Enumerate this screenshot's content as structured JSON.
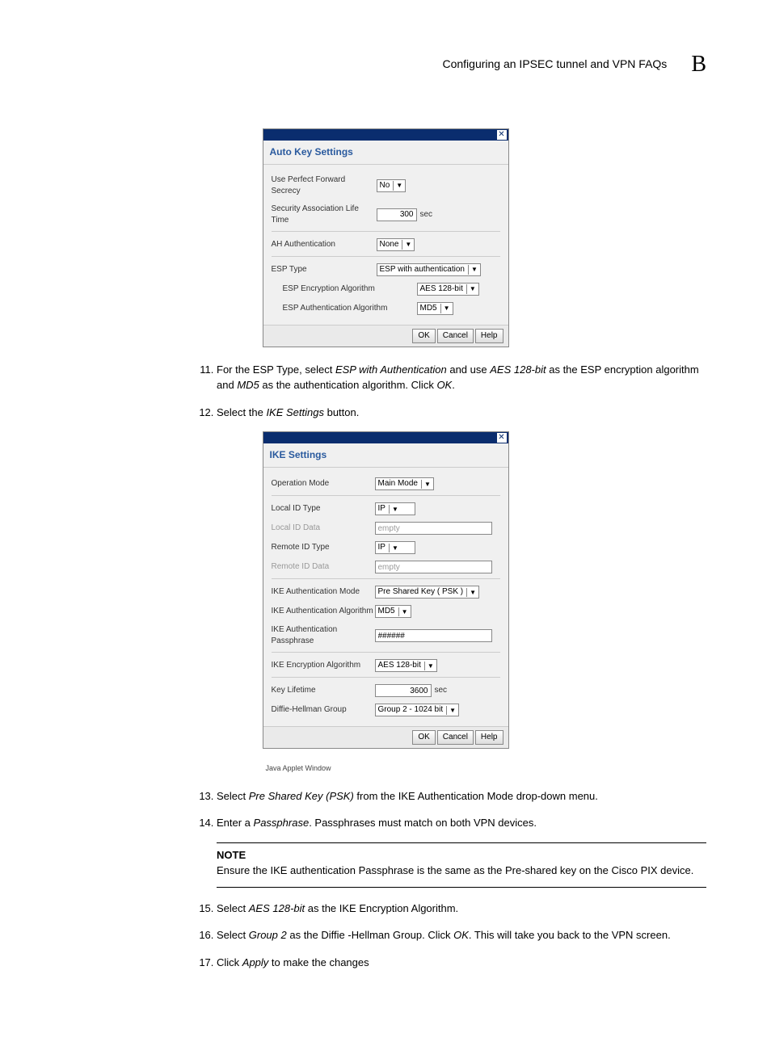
{
  "header": {
    "title": "Configuring an IPSEC tunnel and VPN FAQs",
    "appendix": "B"
  },
  "dialog1": {
    "title": "Auto Key Settings",
    "rows": {
      "pfs": {
        "label": "Use Perfect Forward Secrecy",
        "value": "No"
      },
      "saLife": {
        "label": "Security Association Life Time",
        "value": "300",
        "unit": "sec"
      },
      "ahAuth": {
        "label": "AH Authentication",
        "value": "None"
      },
      "espType": {
        "label": "ESP Type",
        "value": "ESP with authentication"
      },
      "espEnc": {
        "label": "ESP Encryption Algorithm",
        "value": "AES 128-bit"
      },
      "espAuth": {
        "label": "ESP Authentication Algorithm",
        "value": "MD5"
      }
    },
    "buttons": {
      "ok": "OK",
      "cancel": "Cancel",
      "help": "Help"
    }
  },
  "dialog2": {
    "title": "IKE Settings",
    "rows": {
      "opMode": {
        "label": "Operation Mode",
        "value": "Main Mode"
      },
      "localIdType": {
        "label": "Local ID Type",
        "value": "IP"
      },
      "localIdData": {
        "label": "Local ID Data",
        "value": "empty"
      },
      "remoteIdType": {
        "label": "Remote ID Type",
        "value": "IP"
      },
      "remoteIdData": {
        "label": "Remote ID Data",
        "value": "empty"
      },
      "ikeAuthMode": {
        "label": "IKE Authentication Mode",
        "value": "Pre Shared Key ( PSK )"
      },
      "ikeAuthAlg": {
        "label": "IKE Authentication Algorithm",
        "value": "MD5"
      },
      "ikePass": {
        "label": "IKE Authentication Passphrase",
        "value": "######"
      },
      "ikeEnc": {
        "label": "IKE Encryption Algorithm",
        "value": "AES 128-bit"
      },
      "keyLife": {
        "label": "Key Lifetime",
        "value": "3600",
        "unit": "sec"
      },
      "dh": {
        "label": "Diffie-Hellman Group",
        "value": "Group 2 - 1024 bit"
      }
    },
    "buttons": {
      "ok": "OK",
      "cancel": "Cancel",
      "help": "Help"
    },
    "footer": "Java Applet Window"
  },
  "steps": {
    "s11a": "For the ESP Type, select ",
    "s11b": "ESP with Authentication",
    "s11c": " and use ",
    "s11d": "AES 128-bit",
    "s11e": " as the ESP encryption algorithm and ",
    "s11f": "MD5",
    "s11g": " as the authentication algorithm. Click ",
    "s11h": "OK",
    "s11i": ".",
    "s12a": "Select the ",
    "s12b": "IKE Settings",
    "s12c": " button.",
    "s13a": "Select ",
    "s13b": "Pre Shared Key (PSK)",
    "s13c": " from the IKE Authentication Mode drop-down menu.",
    "s14a": "Enter a ",
    "s14b": "Passphrase",
    "s14c": ". Passphrases must match on both VPN devices.",
    "s15a": "Select ",
    "s15b": "AES 128-bit",
    "s15c": " as the IKE Encryption Algorithm.",
    "s16a": "Select ",
    "s16b": "Group 2",
    "s16c": " as the Diffie -Hellman Group. Click ",
    "s16d": "OK",
    "s16e": ". This will take you back to the VPN screen.",
    "s17a": "Click ",
    "s17b": "Apply",
    "s17c": " to make the changes"
  },
  "note": {
    "title": "NOTE",
    "text": "Ensure the IKE authentication Passphrase is the same as the Pre-shared key on the Cisco PIX device."
  }
}
